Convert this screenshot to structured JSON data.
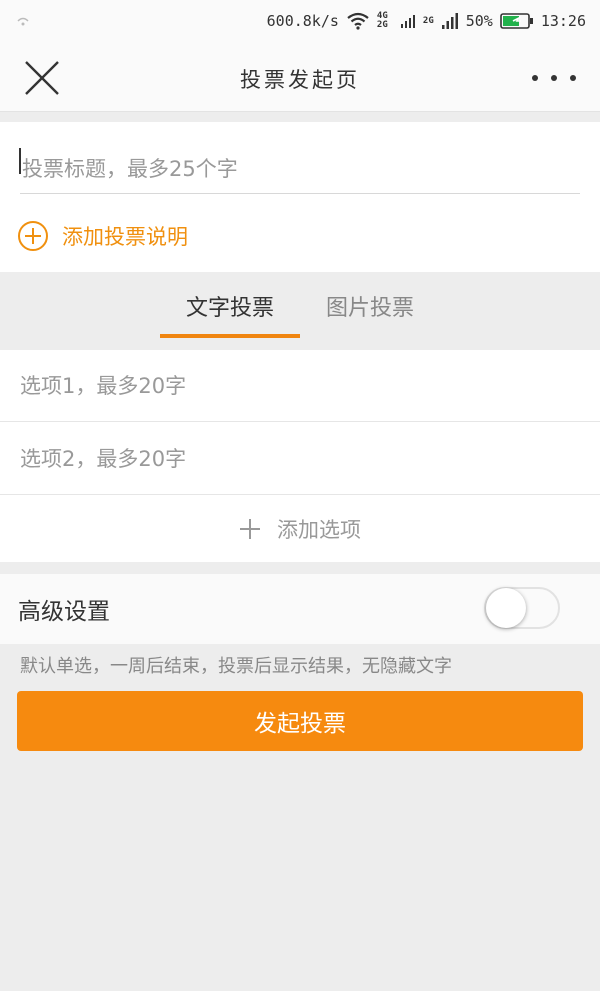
{
  "status_bar": {
    "speed": "600.8k/s",
    "network1": "4G 2G",
    "network2": "2G",
    "battery": "50%",
    "time": "13:26"
  },
  "header": {
    "title": "投票发起页",
    "close_icon": "close-icon",
    "more_icon": "more-icon"
  },
  "title_card": {
    "title_placeholder": "投票标题，最多25个字",
    "add_description_label": "添加投票说明"
  },
  "tabs": [
    {
      "label": "文字投票",
      "active": true
    },
    {
      "label": "图片投票",
      "active": false
    }
  ],
  "options": {
    "option1_placeholder": "选项1，最多20字",
    "option2_placeholder": "选项2，最多20字",
    "add_option_label": "添加选项"
  },
  "advanced": {
    "label": "高级设置",
    "enabled": false,
    "hint": "默认单选，一周后结束，投票后显示结果，无隐藏文字"
  },
  "submit_label": "发起投票",
  "colors": {
    "accent": "#f68a0f",
    "background": "#ededed"
  }
}
